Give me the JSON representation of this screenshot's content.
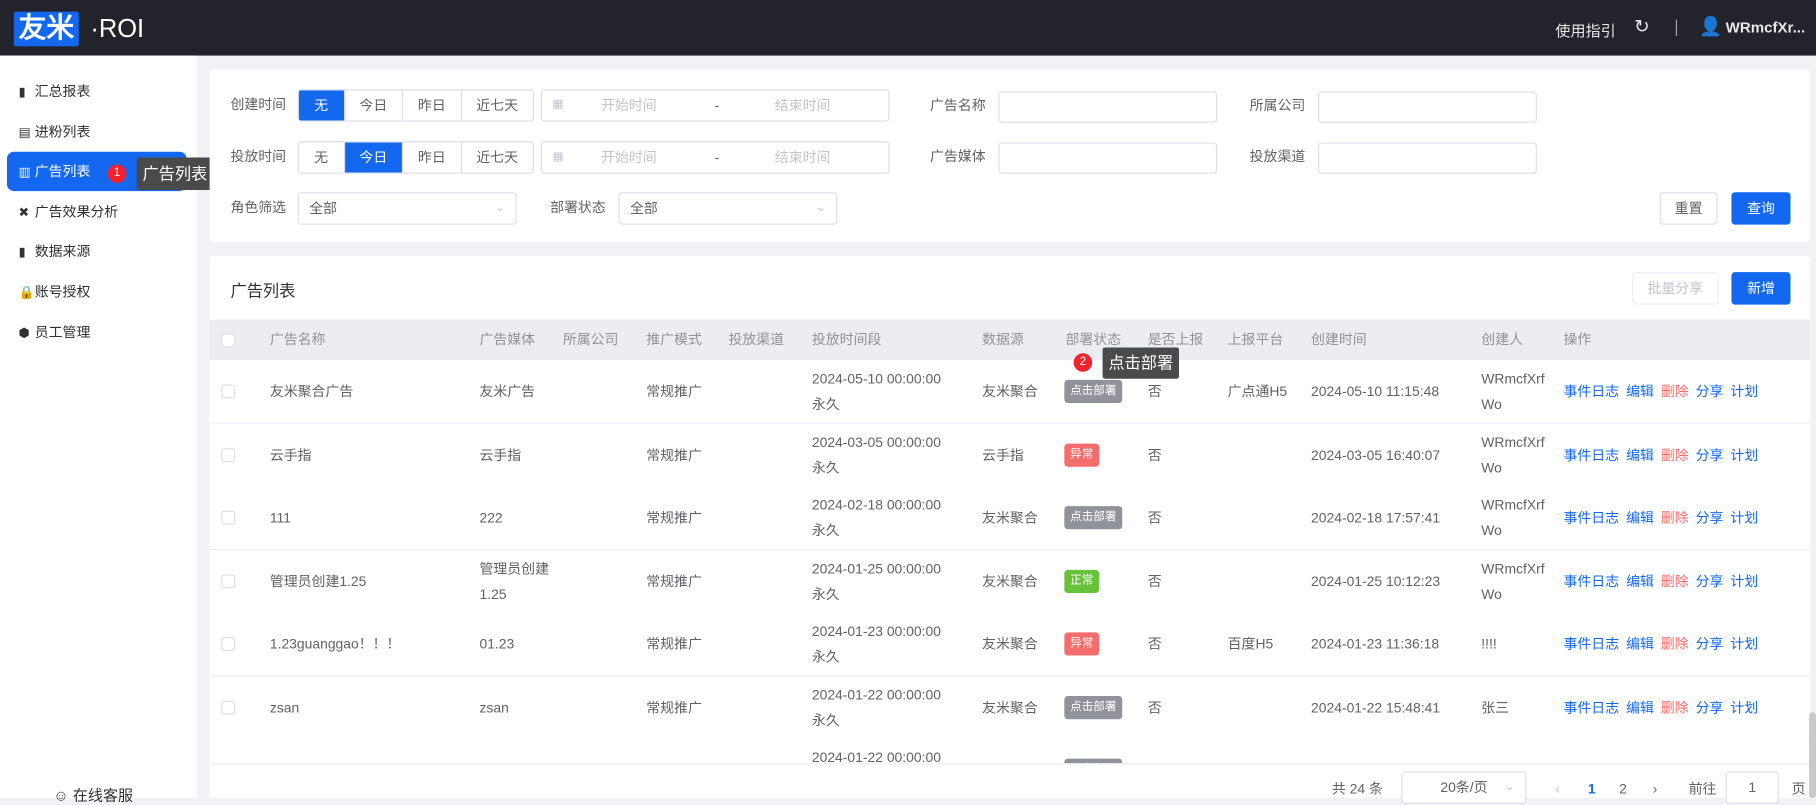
{
  "header": {
    "logo": "友米",
    "logo_suffix": "·ROI",
    "guide": "使用指引",
    "user": "WRmcfXr..."
  },
  "sidebar": {
    "items": [
      {
        "label": "汇总报表",
        "icon": "bar-chart-icon"
      },
      {
        "label": "进粉列表",
        "icon": "list-icon"
      },
      {
        "label": "广告列表",
        "icon": "ad-icon",
        "active": true
      },
      {
        "label": "广告效果分析",
        "icon": "tools-icon"
      },
      {
        "label": "数据来源",
        "icon": "database-icon"
      },
      {
        "label": "账号授权",
        "icon": "lock-icon"
      },
      {
        "label": "员工管理",
        "icon": "shield-icon"
      }
    ],
    "support": "在线客服"
  },
  "guide_tips": [
    {
      "step": "1",
      "text": "广告列表"
    },
    {
      "step": "2",
      "text": "点击部署"
    }
  ],
  "filters": {
    "create_time": {
      "label": "创建时间",
      "options": [
        "无",
        "今日",
        "昨日",
        "近七天"
      ],
      "selected": 0
    },
    "put_time": {
      "label": "投放时间",
      "options": [
        "无",
        "今日",
        "昨日",
        "近七天"
      ],
      "selected": 1
    },
    "start_placeholder": "开始时间",
    "range_sep": "-",
    "end_placeholder": "结束时间",
    "ad_name": {
      "label": "广告名称",
      "value": ""
    },
    "company": {
      "label": "所属公司",
      "value": ""
    },
    "media": {
      "label": "广告媒体",
      "value": ""
    },
    "channel": {
      "label": "投放渠道",
      "value": ""
    },
    "role": {
      "label": "角色筛选",
      "value": "全部"
    },
    "deploy": {
      "label": "部署状态",
      "value": "全部"
    },
    "reset": "重置",
    "query": "查询"
  },
  "list": {
    "title": "广告列表",
    "batch_share": "批量分享",
    "add": "新增",
    "columns": [
      "广告名称",
      "广告媒体",
      "所属公司",
      "推广模式",
      "投放渠道",
      "投放时间段",
      "数据源",
      "部署状态",
      "是否上报",
      "上报平台",
      "创建时间",
      "创建人",
      "操作"
    ],
    "actions": [
      "事件日志",
      "编辑",
      "删除",
      "分享",
      "计划"
    ],
    "rows": [
      {
        "name": "友米聚合广告",
        "media": "友米广告",
        "company": "",
        "mode": "常规推广",
        "channel": "",
        "period": "2024-05-10 00:00:00",
        "period2": "永久",
        "source": "友米聚合",
        "status": "点击部署",
        "report": "否",
        "platform": "广点通H5",
        "created": "2024-05-10 11:15:48",
        "creator": "WRmcfXrfWo"
      },
      {
        "name": "云手指",
        "media": "云手指",
        "company": "",
        "mode": "常规推广",
        "channel": "",
        "period": "2024-03-05 00:00:00",
        "period2": "永久",
        "source": "云手指",
        "status": "异常",
        "report": "否",
        "platform": "",
        "created": "2024-03-05 16:40:07",
        "creator": "WRmcfXrfWo"
      },
      {
        "name": "111",
        "media": "222",
        "company": "",
        "mode": "常规推广",
        "channel": "",
        "period": "2024-02-18 00:00:00",
        "period2": "永久",
        "source": "友米聚合",
        "status": "点击部署",
        "report": "否",
        "platform": "",
        "created": "2024-02-18 17:57:41",
        "creator": "WRmcfXrfWo"
      },
      {
        "name": "管理员创建1.25",
        "media": "管理员创建1.25",
        "company": "",
        "mode": "常规推广",
        "channel": "",
        "period": "2024-01-25 00:00:00",
        "period2": "永久",
        "source": "友米聚合",
        "status": "正常",
        "report": "否",
        "platform": "",
        "created": "2024-01-25 10:12:23",
        "creator": "WRmcfXrfWo"
      },
      {
        "name": "1.23guanggao！！！",
        "media": "01.23",
        "company": "",
        "mode": "常规推广",
        "channel": "",
        "period": "2024-01-23 00:00:00",
        "period2": "永久",
        "source": "友米聚合",
        "status": "异常",
        "report": "否",
        "platform": "百度H5",
        "created": "2024-01-23 11:36:18",
        "creator": "!!!!"
      },
      {
        "name": "zsan",
        "media": "zsan",
        "company": "",
        "mode": "常规推广",
        "channel": "",
        "period": "2024-01-22 00:00:00",
        "period2": "永久",
        "source": "友米聚合",
        "status": "点击部署",
        "report": "否",
        "platform": "",
        "created": "2024-01-22 15:48:41",
        "creator": "张三"
      },
      {
        "name": "",
        "media": "",
        "company": "",
        "mode": "",
        "channel": "",
        "period": "2024-01-22 00:00:00",
        "period2": "",
        "source": "",
        "status": "点击部署",
        "report": "",
        "platform": "",
        "created": "",
        "creator": ""
      }
    ],
    "status_colors": {
      "点击部署": "#909399",
      "异常": "#f56c6c",
      "正常": "#67c23a"
    }
  },
  "pagination": {
    "total": "共 24 条",
    "page_size": "20条/页",
    "pages": [
      "1",
      "2"
    ],
    "current": "1",
    "goto_label": "前往",
    "goto_value": "1",
    "page_suffix": "页"
  }
}
